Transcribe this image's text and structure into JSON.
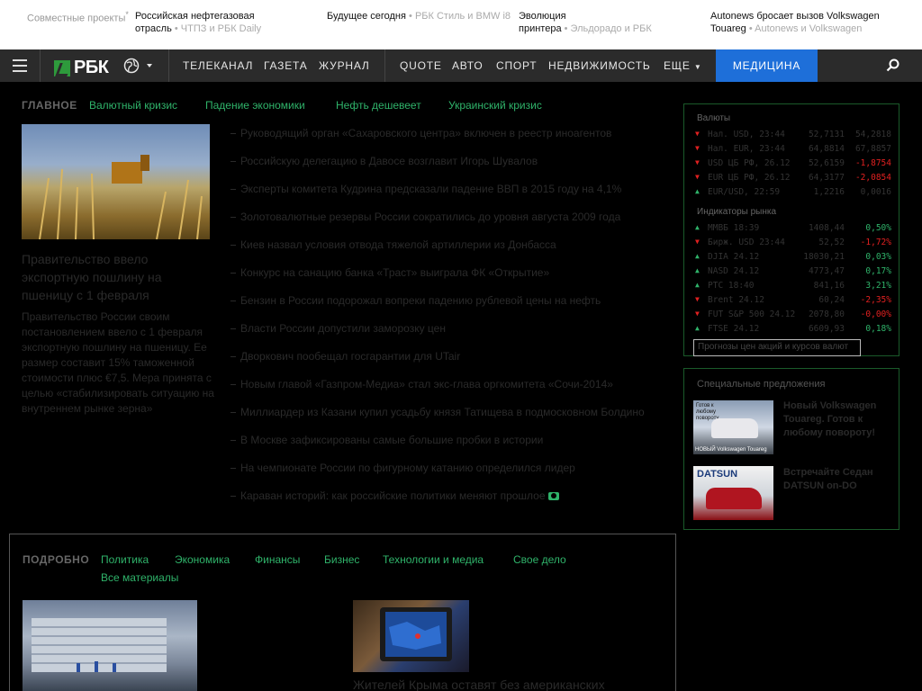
{
  "promo": {
    "label": "Совместные проекты",
    "items": [
      {
        "title_l1": "Российская нефтегазовая",
        "title_l2": "отрасль",
        "source": "ЧТПЗ и РБК Daily"
      },
      {
        "title_l1": "Будущее сегодня",
        "title_l2": "",
        "source": "РБК Стиль и BMW i8"
      },
      {
        "title_l1": "Эволюция",
        "title_l2": "принтера",
        "source": "Эльдорадо и РБК"
      },
      {
        "title_l1": "Autonews бросает вызов Volkswagen",
        "title_l2": "Touareg",
        "source": "Autonews и Volkswagen"
      }
    ]
  },
  "nav": {
    "logo": "РБК",
    "items": [
      "ТЕЛЕКАНАЛ",
      "ГАЗЕТА",
      "ЖУРНАЛ",
      "QUOTE",
      "АВТО",
      "СПОРТ",
      "НЕДВИЖИМОСТЬ",
      "ЕЩЕ"
    ],
    "highlight": "МЕДИЦИНА"
  },
  "main": {
    "tag_label": "ГЛАВНОЕ",
    "tags": [
      "Валютный кризис",
      "Падение экономики",
      "Нефть дешевеет",
      "Украинский кризис"
    ],
    "headline": "Правительство ввело экспортную пошлину на пшеницу с 1 февраля",
    "lead": "Правительство России своим постановлением ввело с 1 февраля экспортную пошлину на пшеницу. Ее размер составит 15% таможенной стоимости плюс €7,5. Мера принята с целью «стабилизировать ситуацию на внутреннем рынке зерна»",
    "news": [
      "Руководящий орган «Сахаровского центра» включен в реестр иноагентов",
      "Российскую делегацию в Давосе возглавит Игорь Шувалов",
      "Эксперты комитета Кудрина предсказали падение ВВП в 2015 году на 4,1%",
      "Золотовалютные резервы России сократились до уровня августа 2009 года",
      "Киев назвал условия отвода тяжелой артиллерии из Донбасса",
      "Конкурс на санацию банка «Траст» выиграла ФК «Открытие»",
      "Бензин в России подорожал вопреки падению рублевой цены на нефть",
      "Власти России допустили заморозку цен",
      "Дворкович пообещал госгарантии для UTair",
      "Новым главой «Газпром-Медиа» стал экс-глава оргкомитета «Сочи-2014»",
      "Миллиардер из Казани купил усадьбу князя Татищева в подмосковном Болдино",
      "В Москве зафиксированы самые большие пробки в истории",
      "На чемпионате России по фигурному катанию определился лидер",
      "Караван историй: как российские политики меняют прошлое"
    ]
  },
  "market": {
    "currency_title": "Валюты",
    "currencies": [
      {
        "dir": "down",
        "name": "Нал. USD, 23:44",
        "v1": "52,7131",
        "v2": "54,2818",
        "color": "nu"
      },
      {
        "dir": "down",
        "name": "Нал. EUR, 23:44",
        "v1": "64,8814",
        "v2": "67,8857",
        "color": "nu"
      },
      {
        "dir": "down",
        "name": "USD ЦБ РФ, 26.12",
        "v1": "52,6159",
        "v2": "-1,8754",
        "color": "dn"
      },
      {
        "dir": "down",
        "name": "EUR ЦБ РФ, 26.12",
        "v1": "64,3177",
        "v2": "-2,0854",
        "color": "dn"
      },
      {
        "dir": "up",
        "name": "EUR/USD, 22:59",
        "v1": "1,2216",
        "v2": "0,0016",
        "color": "nu"
      }
    ],
    "indicators_title": "Индикаторы рынка",
    "indicators": [
      {
        "dir": "up",
        "name": "ММВБ 18:39",
        "v1": "1408,44",
        "v2": "0,50%",
        "color": "up"
      },
      {
        "dir": "down",
        "name": "Бирж. USD 23:44",
        "v1": "52,52",
        "v2": "-1,72%",
        "color": "dn"
      },
      {
        "dir": "up",
        "name": "DJIA 24.12",
        "v1": "18030,21",
        "v2": "0,03%",
        "color": "up"
      },
      {
        "dir": "up",
        "name": "NASD 24.12",
        "v1": "4773,47",
        "v2": "0,17%",
        "color": "up"
      },
      {
        "dir": "up",
        "name": "РТС 18:40",
        "v1": "841,16",
        "v2": "3,21%",
        "color": "up"
      },
      {
        "dir": "down",
        "name": "Brent 24.12",
        "v1": "60,24",
        "v2": "-2,35%",
        "color": "dn"
      },
      {
        "dir": "down",
        "name": "FUT S&P 500 24.12",
        "v1": "2078,80",
        "v2": "-0,00%",
        "color": "dn"
      },
      {
        "dir": "up",
        "name": "FTSE 24.12",
        "v1": "6609,93",
        "v2": "0,18%",
        "color": "up"
      }
    ],
    "forecast": "Прогнозы цен акций и курсов валют"
  },
  "special": {
    "title": "Специальные предложения",
    "items": [
      {
        "text": "Новый Volkswagen Touareg. Готов к любому повороту!",
        "img_top": "Готов к любому повороту",
        "img_bottom": "НОВЫЙ Volkswagen Touareg"
      },
      {
        "text": "Встречайте Седан DATSUN on-DO",
        "img_top": "DATSUN",
        "img_bottom": ""
      }
    ]
  },
  "detail": {
    "tag_label": "ПОДРОБНО",
    "tags": [
      "Политика",
      "Экономика",
      "Финансы",
      "Бизнес",
      "Технологии и медиа",
      "Свое дело",
      "Все материалы"
    ],
    "article": "Жителей Крыма оставят без американских"
  },
  "colors": {
    "accent_green": "#2fb36a",
    "accent_blue": "#1e6fd9",
    "down_red": "#e02020"
  }
}
